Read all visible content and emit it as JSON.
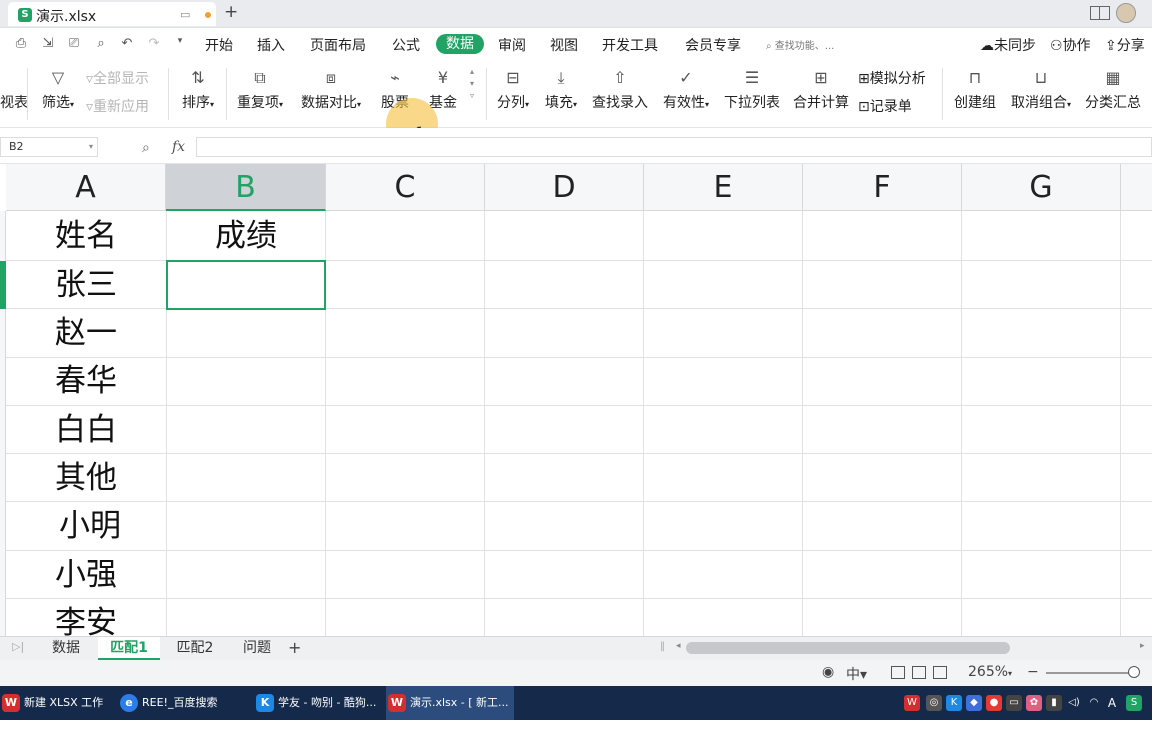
{
  "window": {
    "doc_title": "演示.xlsx",
    "doc_icon_letter": "S",
    "new_tab": "+"
  },
  "menu": {
    "items": [
      "开始",
      "插入",
      "页面布局",
      "公式",
      "数据",
      "审阅",
      "视图",
      "开发工具",
      "会员专享"
    ],
    "active": "数据",
    "search_placeholder": "查找功能、...",
    "right": [
      "未同步",
      "协作",
      "分享"
    ]
  },
  "ribbon": {
    "partial_left": "视表",
    "filter": "筛选",
    "show_all": "全部显示",
    "reapply": "重新应用",
    "sort": "排序",
    "duplicates": "重复项",
    "compare": "数据对比",
    "stock": "股票",
    "fund": "基金",
    "split_column": "分列",
    "fill": "填充",
    "lookup_entry": "查找录入",
    "validation": "有效性",
    "dropdown_list": "下拉列表",
    "consolidate": "合并计算",
    "what_if": "模拟分析",
    "record_form": "记录单",
    "group": "创建组",
    "ungroup": "取消组合",
    "subtotal": "分类汇总"
  },
  "formula_bar": {
    "name_box": "B2",
    "fx_label": "fx",
    "formula": ""
  },
  "sheet": {
    "columns": [
      "A",
      "B",
      "C",
      "D",
      "E",
      "F",
      "G"
    ],
    "selected_column": "B",
    "active_cell": "B2",
    "header_row": [
      "姓名",
      "成绩"
    ],
    "names": [
      "张三",
      "赵一",
      "春华",
      "白白",
      "其他",
      "小明",
      "小强",
      "李安"
    ]
  },
  "sheet_tabs": {
    "tabs": [
      "数据",
      "匹配1",
      "匹配2",
      "问题"
    ],
    "active": "匹配1",
    "add": "+"
  },
  "status": {
    "zoom": "265%",
    "zoom_minus": "−",
    "zoom_fraction": 0.93
  },
  "taskbar": {
    "items": [
      {
        "icon": "wps-icon",
        "label": "新建 XLSX 工作表...."
      },
      {
        "icon": "browser-icon",
        "label": "REE!_百度搜索"
      },
      {
        "icon": "kugou-icon",
        "label": "学友 - 吻别 - 酷狗..."
      },
      {
        "icon": "wps-icon",
        "label": "演示.xlsx - [ 新工..."
      }
    ],
    "active_index": 3,
    "ime": "A"
  },
  "colors": {
    "accent": "#21a366",
    "taskbar": "#152a4a",
    "cursor_halo": "#f5be3c"
  }
}
